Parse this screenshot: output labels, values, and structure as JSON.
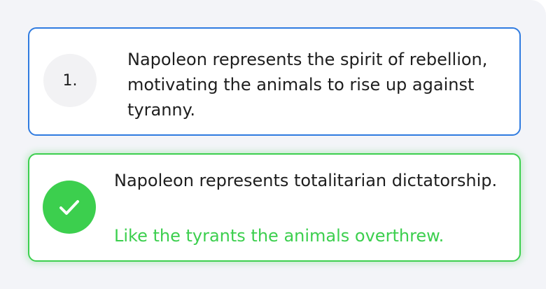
{
  "options": [
    {
      "number": "1.",
      "text": "Napoleon represents the spirit of rebellion, motivating the animals to rise up against tyranny.",
      "state": "selected-neutral"
    },
    {
      "icon": "checkmark-icon",
      "text": "Napoleon represents totalitarian dictatorship.",
      "feedback": "Like the tyrants the animals overthrew.",
      "state": "correct"
    }
  ],
  "colors": {
    "selected_border": "#2f7be0",
    "correct": "#3ccf4e",
    "background": "#f3f4f8"
  }
}
